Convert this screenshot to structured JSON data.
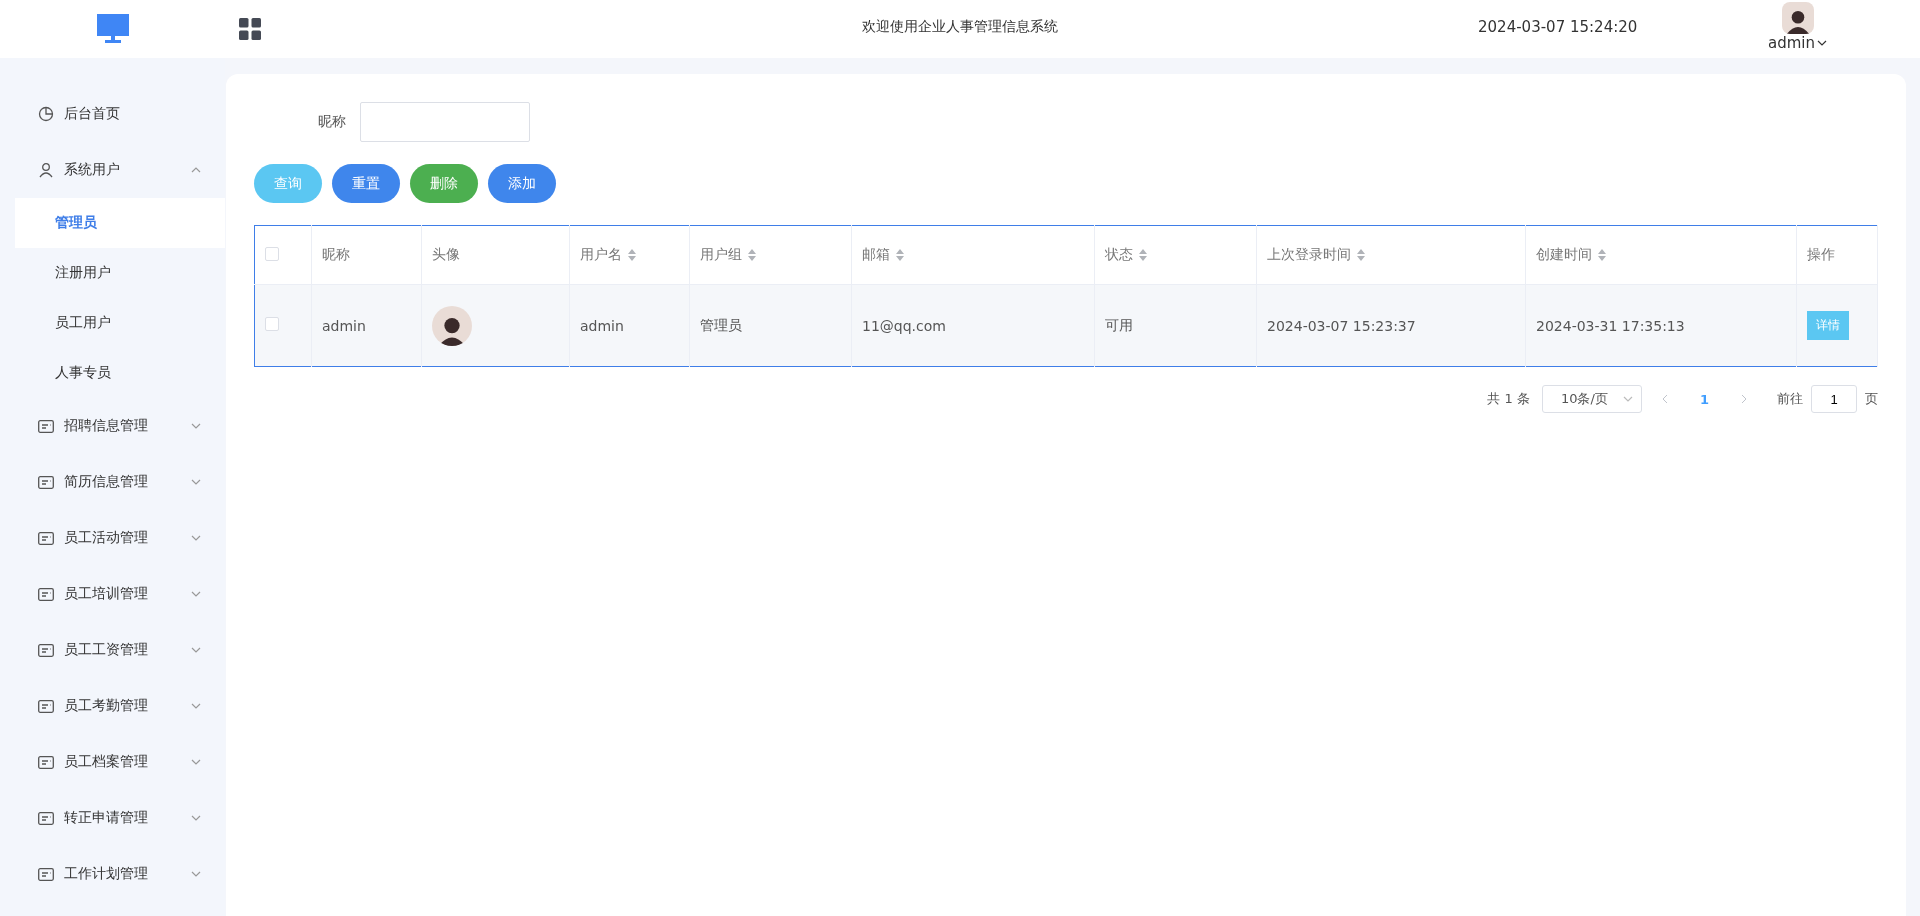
{
  "header": {
    "title": "欢迎使用企业人事管理信息系统",
    "datetime": "2024-03-07 15:24:20",
    "user": "admin"
  },
  "sidebar": {
    "items": [
      {
        "label": "后台首页",
        "kind": "link"
      },
      {
        "label": "系统用户",
        "kind": "group",
        "expanded": true,
        "children": [
          {
            "label": "管理员",
            "selected": true
          },
          {
            "label": "注册用户",
            "selected": false
          },
          {
            "label": "员工用户",
            "selected": false
          },
          {
            "label": "人事专员",
            "selected": false
          }
        ]
      },
      {
        "label": "招聘信息管理",
        "kind": "group",
        "expanded": false
      },
      {
        "label": "简历信息管理",
        "kind": "group",
        "expanded": false
      },
      {
        "label": "员工活动管理",
        "kind": "group",
        "expanded": false
      },
      {
        "label": "员工培训管理",
        "kind": "group",
        "expanded": false
      },
      {
        "label": "员工工资管理",
        "kind": "group",
        "expanded": false
      },
      {
        "label": "员工考勤管理",
        "kind": "group",
        "expanded": false
      },
      {
        "label": "员工档案管理",
        "kind": "group",
        "expanded": false
      },
      {
        "label": "转正申请管理",
        "kind": "group",
        "expanded": false
      },
      {
        "label": "工作计划管理",
        "kind": "group",
        "expanded": false
      }
    ]
  },
  "search": {
    "label": "昵称"
  },
  "buttons": [
    {
      "label": "查询",
      "color": "#5bc7f2"
    },
    {
      "label": "重置",
      "color": "#3f86ec"
    },
    {
      "label": "删除",
      "color": "#4caf50"
    },
    {
      "label": "添加",
      "color": "#3f86ec"
    }
  ],
  "table": {
    "select_all": {
      "checked": false
    },
    "columns": [
      {
        "label": "昵称",
        "sortable": false
      },
      {
        "label": "头像",
        "sortable": false
      },
      {
        "label": "用户名",
        "sortable": true
      },
      {
        "label": "用户组",
        "sortable": true
      },
      {
        "label": "邮箱",
        "sortable": true
      },
      {
        "label": "状态",
        "sortable": true
      },
      {
        "label": "上次登录时间",
        "sortable": true
      },
      {
        "label": "创建时间",
        "sortable": true
      },
      {
        "label": "操作",
        "sortable": false
      }
    ],
    "rows": [
      {
        "checked": false,
        "cells": [
          {
            "kind": "text",
            "text": "admin"
          },
          {
            "kind": "avatar"
          },
          {
            "kind": "text",
            "text": "admin"
          },
          {
            "kind": "text",
            "text": "管理员"
          },
          {
            "kind": "text",
            "text": "11@qq.com"
          },
          {
            "kind": "text",
            "text": "可用"
          },
          {
            "kind": "text",
            "text": "2024-03-07 15:23:37"
          },
          {
            "kind": "text",
            "text": "2024-03-31 17:35:13"
          },
          {
            "kind": "action",
            "text": "详情"
          }
        ]
      }
    ]
  },
  "pagination": {
    "total": "共 1 条",
    "page_size": "10条/页",
    "pages": [
      {
        "label": "1",
        "selected": true
      }
    ],
    "goto_label": "前往",
    "goto_value": "1",
    "page_unit": "页"
  }
}
